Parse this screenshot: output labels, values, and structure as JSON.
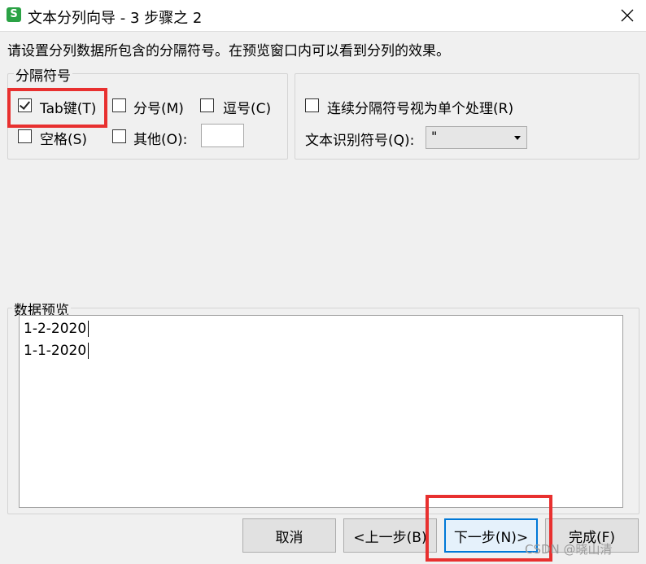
{
  "window": {
    "title": "文本分列向导 - 3 步骤之 2",
    "app_icon_letter": "S",
    "close_glyph": "✕"
  },
  "instruction": "请设置分列数据所包含的分隔符号。在预览窗口内可以看到分列的效果。",
  "delimiters": {
    "group_label": "分隔符号",
    "tab": {
      "label": "Tab键(T)",
      "checked": true
    },
    "semicolon": {
      "label": "分号(M)",
      "checked": false
    },
    "comma": {
      "label": "逗号(C)",
      "checked": false
    },
    "space": {
      "label": "空格(S)",
      "checked": false
    },
    "other": {
      "label": "其他(O):",
      "checked": false,
      "value": ""
    }
  },
  "options": {
    "consecutive": {
      "label": "连续分隔符号视为单个处理(R)",
      "checked": false
    },
    "qualifier_label": "文本识别符号(Q):",
    "qualifier_value": "\""
  },
  "preview": {
    "group_label": "数据预览",
    "lines": [
      "1-2-2020",
      "1-1-2020"
    ]
  },
  "buttons": {
    "cancel": "取消",
    "back": "<上一步(B)",
    "next": "下一步(N)>",
    "finish": "完成(F)"
  },
  "watermark": "CSDN @晓山清"
}
